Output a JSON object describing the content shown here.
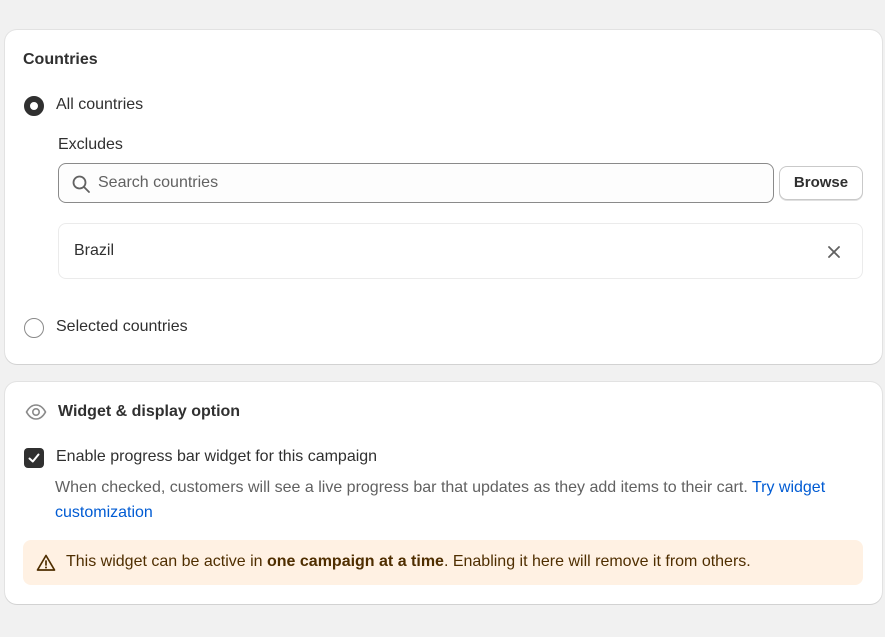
{
  "countries_card": {
    "title": "Countries",
    "option_all": "All countries",
    "excludes_label": "Excludes",
    "search_placeholder": "Search countries",
    "browse_label": "Browse",
    "excluded_countries": [
      "Brazil"
    ],
    "option_selected": "Selected countries",
    "selected_option": "All countries"
  },
  "widget_card": {
    "title": "Widget & display option",
    "checkbox_label": "Enable progress bar widget for this campaign",
    "checkbox_checked": true,
    "help_text": "When checked, customers will see a live progress bar that updates as they add items to their cart.",
    "help_link": "Try widget customization",
    "banner": {
      "prefix": "This widget can be active in ",
      "bold": "one campaign at a time",
      "suffix": ". Enabling it here will remove it from others."
    }
  },
  "icons": {
    "search": "search-icon",
    "remove": "close-icon",
    "eye": "eye-icon",
    "check": "checkmark-icon",
    "warning": "warning-icon"
  },
  "colors": {
    "background": "#f1f1f1",
    "link": "#005bd3",
    "banner_bg": "#fff1e3",
    "banner_text": "#4f2e00",
    "dark": "#303030"
  }
}
